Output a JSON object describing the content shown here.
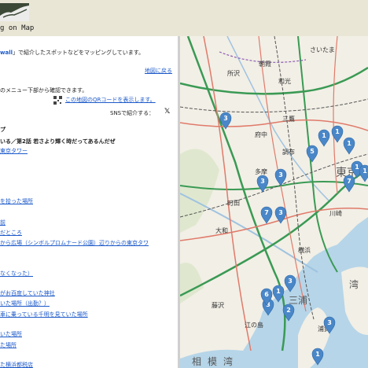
{
  "header": {
    "title": "g on Map"
  },
  "panel": {
    "intro_link": "wall",
    "intro_text": "」で紹介したスポットなどをマッピングしています。",
    "back_to_map": "地図に戻る",
    "menu_note": "のメニュー下部から確認できます。",
    "qr_link": "この地図のQRコードを表示します。",
    "sns_label": "SNSで紹介する：",
    "x_icon": "𝕏",
    "heading_fragment": "プ",
    "episode_line": "いる／第2話 若さより輝く時だってあるんだぜ",
    "tower_link": "東京タワー",
    "spots": [
      "を拾った場所",
      "前",
      "だところ",
      "から広場（シンボルプロムナード公園）辺りからの東京タワ",
      "なくなった）",
      "がお百度していた神社",
      "いた場所（出勤？）",
      "車に乗っている千明を見ていた場所",
      "いた場所",
      "た場所",
      "た横浜都税店"
    ]
  },
  "map": {
    "labels": [
      "所沢",
      "三鷹",
      "調布",
      "町田",
      "大和",
      "藤沢",
      "江の島",
      "相模湾",
      "三浦",
      "浦賀",
      "東京",
      "川崎",
      "横浜",
      "多摩",
      "府中",
      "さいたま",
      "朝霞",
      "和光",
      "湾"
    ],
    "pins": [
      "3",
      "5",
      "3",
      "3",
      "7",
      "1",
      "1",
      "1",
      "1",
      "1",
      "3",
      "3",
      "2",
      "6",
      "1",
      "3",
      "1",
      "7",
      "3"
    ],
    "colors": {
      "pin": "#4a87c8",
      "expressway": "#3a9a54",
      "national_road": "#e07a6a",
      "rail": "#555555",
      "water": "#b6d5e8",
      "land": "#f2efe6"
    }
  }
}
